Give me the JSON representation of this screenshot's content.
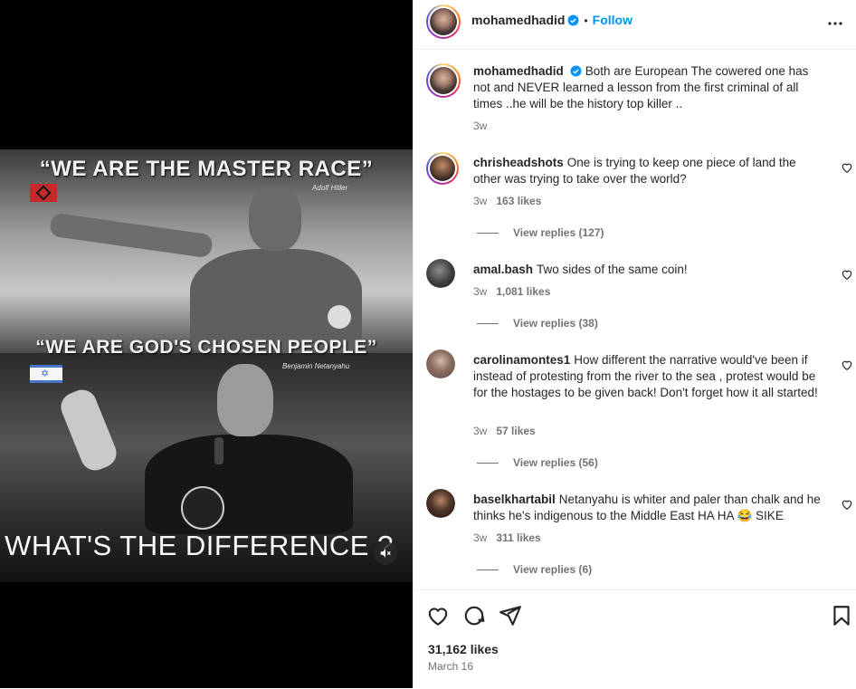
{
  "post_image": {
    "top_headline": "“WE ARE THE MASTER RACE”",
    "top_attribution": "Adolf Hitler",
    "middle_headline": "“WE ARE GOD'S CHOSEN PEOPLE”",
    "middle_attribution": "Benjamin Netanyahu",
    "bottom_caption": "WHAT'S THE DIFFERENCE ?",
    "mute_icon": "speaker-muted-icon"
  },
  "header": {
    "username": "mohamedhadid",
    "separator": "•",
    "follow_label": "Follow",
    "more_icon": "more-horizontal-icon"
  },
  "caption": {
    "username": "mohamedhadid",
    "text": "Both are European The cowered one has not and NEVER learned a lesson from the first criminal of all times ..he will be the history top killer ..",
    "time": "3w"
  },
  "comments": [
    {
      "username": "chrisheadshots",
      "text": "One is trying to keep one piece of land the other was trying to take over the world?",
      "time": "3w",
      "likes": "163 likes",
      "replies": "View replies (127)"
    },
    {
      "username": "amal.bash",
      "text": "Two sides of the same coin!",
      "time": "3w",
      "likes": "1,081 likes",
      "replies": "View replies (38)"
    },
    {
      "username": "carolinamontes1",
      "text": "How different the narrative would've been if instead of protesting from the river to the sea , protest would be for the hostages to be given back! Don't forget how it all started!",
      "time": "3w",
      "likes": "57 likes",
      "replies": "View replies (56)"
    },
    {
      "username": "baselkhartabil",
      "text": "Netanyahu is whiter and paler than chalk and he thinks he's indigenous to the Middle East HA HA 😂 SIKE",
      "time": "3w",
      "likes": "311 likes",
      "replies": "View replies (6)"
    }
  ],
  "footer": {
    "likes_count": "31,162 likes",
    "date": "March 16"
  },
  "colors": {
    "accent": "#0095f6",
    "text": "#262626",
    "muted": "#737373",
    "divider": "#efefef"
  }
}
